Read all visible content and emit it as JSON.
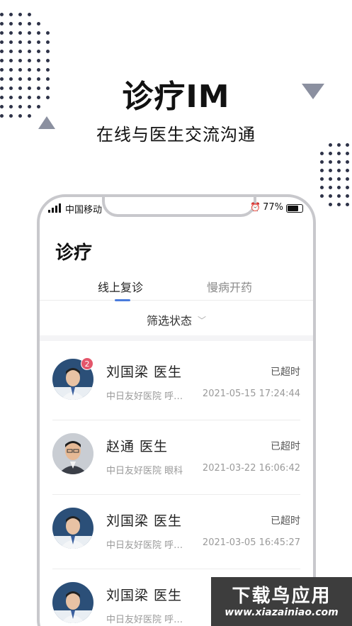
{
  "hero": {
    "title": "诊疗IM",
    "subtitle": "在线与医生交流沟通"
  },
  "status_bar": {
    "carrier": "中国移动",
    "battery": "77%",
    "battery_level": 0.77
  },
  "page": {
    "title": "诊疗"
  },
  "tabs": [
    {
      "label": "线上复诊",
      "active": true
    },
    {
      "label": "慢病开药",
      "active": false
    }
  ],
  "filter": {
    "label": "筛选状态"
  },
  "consultations": [
    {
      "name": "刘国梁   医生",
      "status": "已超时",
      "hospital": "中日友好医院 呼…",
      "time": "2021-05-15 17:24:44",
      "unread": "2"
    },
    {
      "name": "赵通   医生",
      "status": "已超时",
      "hospital": "中日友好医院 眼科",
      "time": "2021-03-22 16:06:42",
      "unread": ""
    },
    {
      "name": "刘国梁   医生",
      "status": "已超时",
      "hospital": "中日友好医院 呼…",
      "time": "2021-03-05 16:45:27",
      "unread": ""
    },
    {
      "name": "刘国梁   医生",
      "status": "",
      "hospital": "中日友好医院 呼…",
      "time": "20",
      "unread": ""
    }
  ],
  "watermark": {
    "brand": "下载鸟应用",
    "url": "www.xiazainiao.com"
  },
  "colors": {
    "accent": "#4a7bdc",
    "badge": "#e4566b",
    "dots": "#2e3348"
  }
}
